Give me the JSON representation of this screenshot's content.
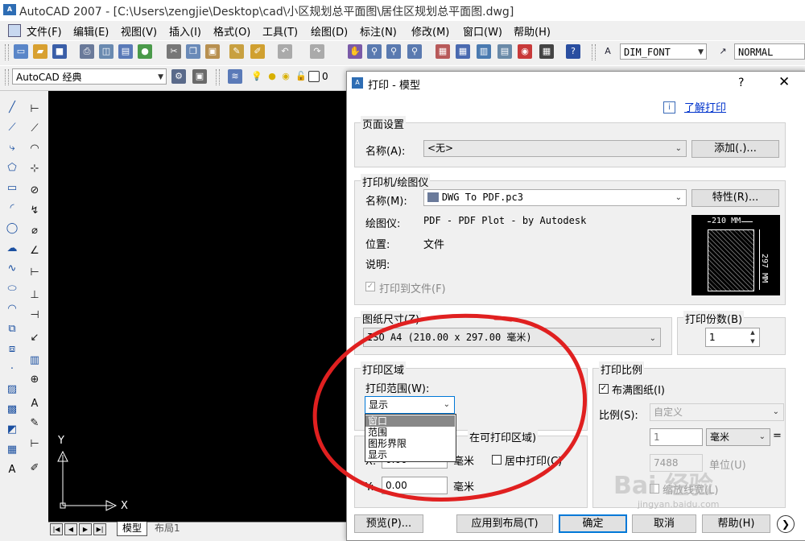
{
  "window": {
    "title": "AutoCAD 2007 - [C:\\Users\\zengjie\\Desktop\\cad\\小区规划总平面图\\居住区规划总平面图.dwg]"
  },
  "menu": [
    "文件(F)",
    "编辑(E)",
    "视图(V)",
    "插入(I)",
    "格式(O)",
    "工具(T)",
    "绘图(D)",
    "标注(N)",
    "修改(M)",
    "窗口(W)",
    "帮助(H)"
  ],
  "toolbar": {
    "dim_font": "DIM_FONT",
    "normal_style": "NORMAL",
    "workspace": "AutoCAD 经典",
    "layer_value": "0"
  },
  "canvas": {
    "axis_y": "Y",
    "axis_x": "X",
    "tab_model": "模型",
    "tab_layout": "布局1"
  },
  "dialog": {
    "title": "打印 - 模型",
    "help_char": "?",
    "learn_link": "了解打印",
    "page_setup": {
      "title": "页面设置",
      "name_label": "名称(A):",
      "name_value": "<无>",
      "add_button": "添加(.)..."
    },
    "printer": {
      "title": "打印机/绘图仪",
      "name_label": "名称(M):",
      "name_value": "DWG To PDF.pc3",
      "props_button": "特性(R)...",
      "plotter_label": "绘图仪:",
      "plotter_value": "PDF - PDF Plot - by Autodesk",
      "location_label": "位置:",
      "location_value": "文件",
      "desc_label": "说明:",
      "print_to_file": "打印到文件(F)",
      "preview_width": "210 MM",
      "preview_height": "297 MM"
    },
    "paper": {
      "title": "图纸尺寸(Z)",
      "value": "ISO A4 (210.00 x 297.00 毫米)"
    },
    "copies": {
      "title": "打印份数(B)",
      "value": "1"
    },
    "area": {
      "title": "打印区域",
      "range_label": "打印范围(W):",
      "range_value": "显示",
      "options": [
        "窗口",
        "范围",
        "图形界限",
        "显示"
      ]
    },
    "offset": {
      "title_tail": "在可打印区域)",
      "x_label": "X:",
      "x_value": "0.00",
      "x_unit": "毫米",
      "y_label": "Y:",
      "y_value": "0.00",
      "y_unit": "毫米",
      "center": "居中打印(C)"
    },
    "scale": {
      "title": "打印比例",
      "fit": "布满图纸(I)",
      "ratio_label": "比例(S):",
      "ratio_value": "自定义",
      "num_value": "1",
      "unit_value": "毫米",
      "eq": "=",
      "den_value": "7488",
      "unit_label": "单位(U)",
      "scale_lineweights": "缩放线宽(L)"
    },
    "buttons": {
      "preview": "预览(P)...",
      "apply": "应用到布局(T)",
      "ok": "确定",
      "cancel": "取消",
      "help": "帮助(H)"
    }
  },
  "watermark": {
    "brand": "Bai 经验",
    "url": "jingyan.baidu.com"
  }
}
